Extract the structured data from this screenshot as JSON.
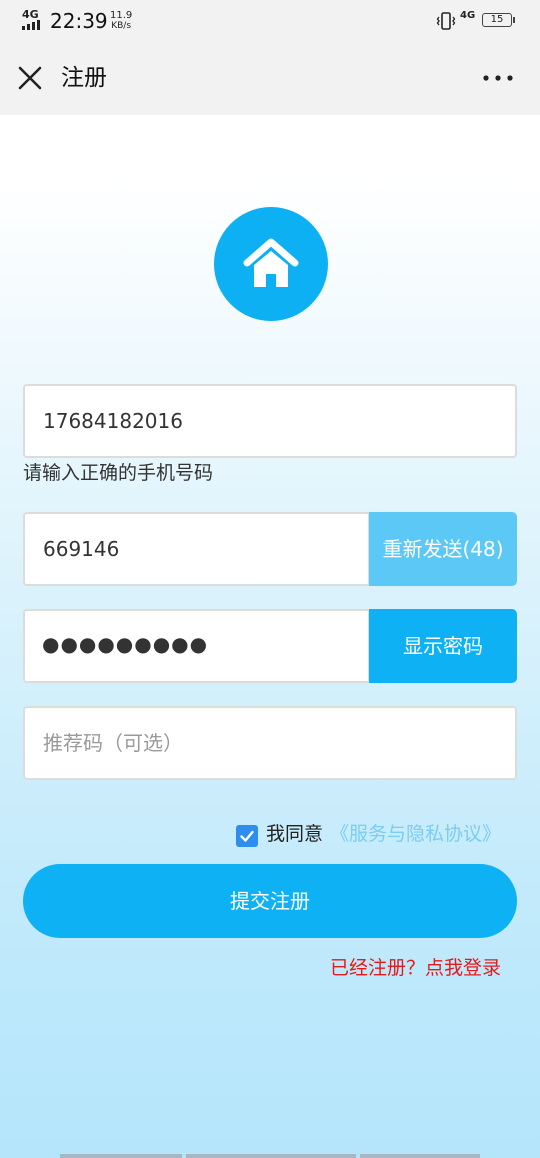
{
  "status_bar": {
    "network_left": "4G",
    "time": "22:39",
    "speed_value": "11.9",
    "speed_unit": "KB/s",
    "network_right": "4G",
    "battery": "15"
  },
  "nav": {
    "title": "注册",
    "close_icon": "close-icon",
    "more_icon": "more-icon"
  },
  "logo": {
    "icon": "home-icon",
    "color": "#0eb0f4"
  },
  "form": {
    "phone": {
      "value": "17684182016",
      "hint": "请输入正确的手机号码"
    },
    "code": {
      "value": "669146",
      "resend_label": "重新发送(48)"
    },
    "password": {
      "masked": "●●●●●●●●●",
      "show_label": "显示密码"
    },
    "referral": {
      "placeholder": "推荐码（可选）"
    }
  },
  "agreement": {
    "checked": true,
    "text": "我同意",
    "link": "《服务与隐私协议》"
  },
  "submit_label": "提交注册",
  "login_link": "已经注册？点我登录",
  "colors": {
    "primary": "#0eb2f4",
    "primary_light": "#5cc8f6",
    "link": "#7ccdf2",
    "error": "#e21b1b",
    "checkbox": "#2d8ef0"
  }
}
